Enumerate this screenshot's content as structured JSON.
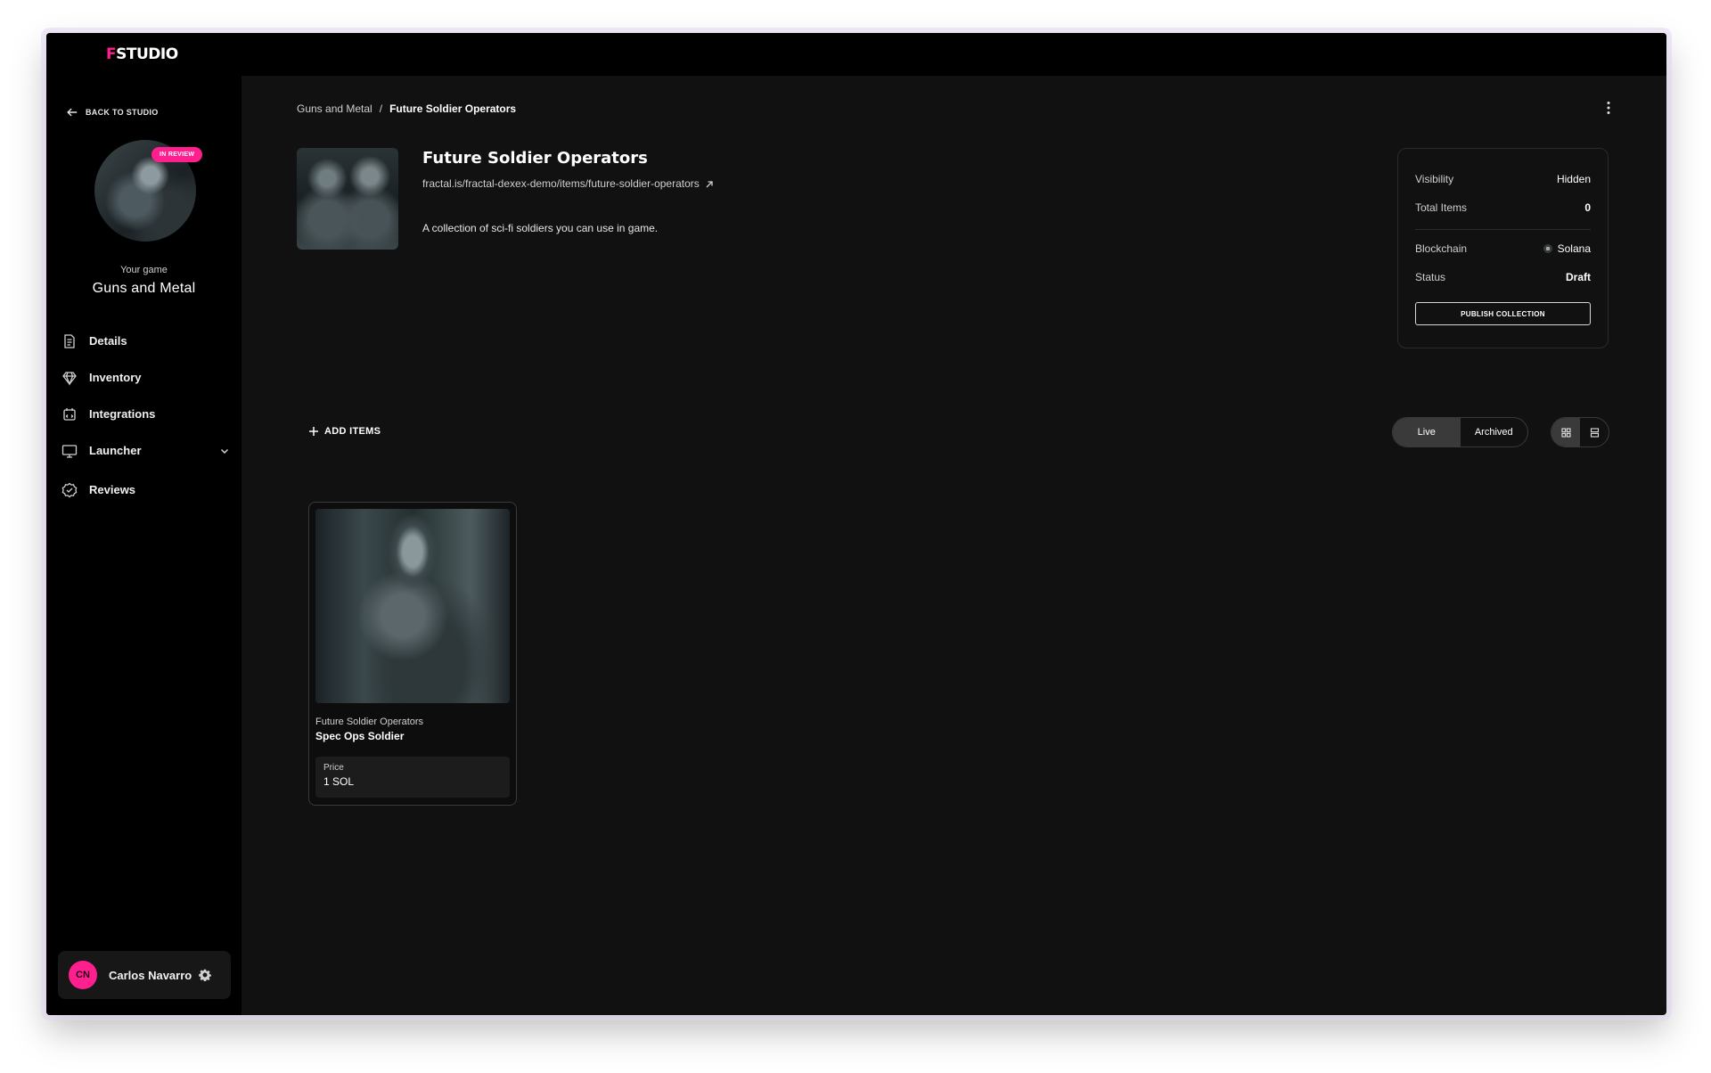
{
  "brand": {
    "logo_first": "F",
    "logo_rest": "STUDIO",
    "accent": "#ff1f8e"
  },
  "sidebar": {
    "back_label": "BACK TO STUDIO",
    "badge": "IN REVIEW",
    "your_game_label": "Your game",
    "game_name": "Guns and Metal",
    "items": [
      {
        "label": "Details",
        "icon": "document-icon"
      },
      {
        "label": "Inventory",
        "icon": "diamond-icon"
      },
      {
        "label": "Integrations",
        "icon": "plug-icon"
      },
      {
        "label": "Launcher",
        "icon": "monitor-icon",
        "expandable": true
      },
      {
        "label": "Reviews",
        "icon": "check-badge-icon"
      }
    ],
    "user": {
      "initials": "CN",
      "name": "Carlos Navarro"
    }
  },
  "breadcrumb": {
    "parent": "Guns and Metal",
    "separator": "/",
    "current": "Future Soldier Operators"
  },
  "collection": {
    "title": "Future Soldier Operators",
    "url": "fractal.is/fractal-dexex-demo/items/future-soldier-operators",
    "description": "A collection of sci-fi soldiers you can use in game."
  },
  "info": {
    "visibility_label": "Visibility",
    "visibility_value": "Hidden",
    "total_items_label": "Total Items",
    "total_items_value": "0",
    "blockchain_label": "Blockchain",
    "blockchain_value": "Solana",
    "status_label": "Status",
    "status_value": "Draft",
    "publish_label": "PUBLISH COLLECTION"
  },
  "toolbar": {
    "add_items_label": "ADD ITEMS",
    "tabs": [
      "Live",
      "Archived"
    ],
    "active_tab": "Live",
    "view_modes": [
      "grid-view-icon",
      "list-view-icon"
    ],
    "active_view": "grid-view-icon"
  },
  "items": [
    {
      "collection": "Future Soldier Operators",
      "name": "Spec Ops Soldier",
      "price_label": "Price",
      "price_value": "1 SOL"
    }
  ]
}
